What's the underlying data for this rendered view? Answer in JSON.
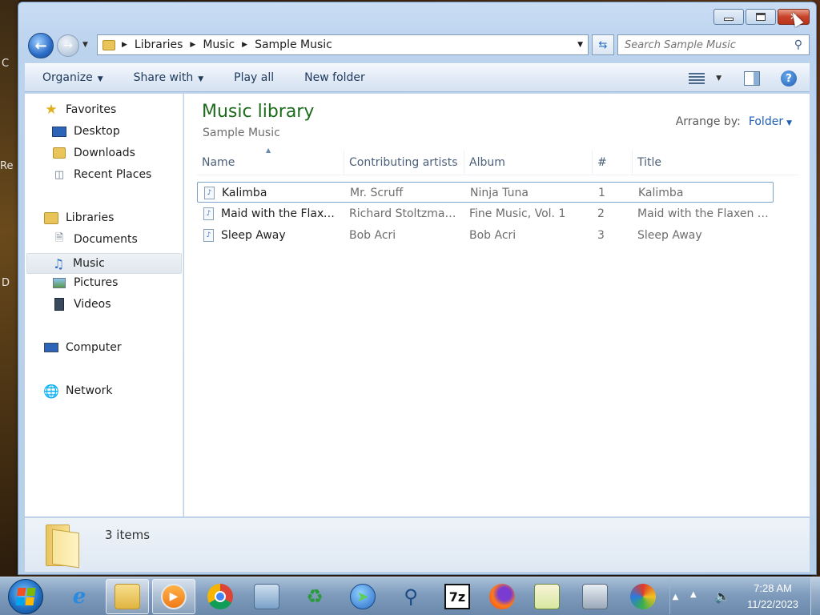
{
  "window": {
    "caption": {
      "minimize": "–",
      "maximize": "□",
      "close": "✕"
    }
  },
  "address_bar": {
    "breadcrumb": [
      "Libraries",
      "Music",
      "Sample Music"
    ]
  },
  "search": {
    "placeholder": "Search Sample Music"
  },
  "command_bar": {
    "organize": "Organize",
    "share_with": "Share with",
    "play_all": "Play all",
    "new_folder": "New folder"
  },
  "nav_pane": {
    "favorites": {
      "label": "Favorites",
      "items": [
        "Desktop",
        "Downloads",
        "Recent Places"
      ]
    },
    "libraries": {
      "label": "Libraries",
      "items": [
        "Documents",
        "Music",
        "Pictures",
        "Videos"
      ],
      "selected": "Music"
    },
    "computer": "Computer",
    "network": "Network"
  },
  "content": {
    "title": "Music library",
    "subtitle": "Sample Music",
    "arrange_by_label": "Arrange by:",
    "arrange_by_value": "Folder",
    "columns": [
      "Name",
      "Contributing artists",
      "Album",
      "#",
      "Title"
    ],
    "rows": [
      {
        "name": "Kalimba",
        "artists": "Mr. Scruff",
        "album": "Ninja Tuna",
        "num": "1",
        "title": "Kalimba",
        "selected": true
      },
      {
        "name": "Maid with the Flaxe...",
        "artists": "Richard Stoltzman;...",
        "album": "Fine Music, Vol. 1",
        "num": "2",
        "title": "Maid with the Flaxen H...",
        "selected": false
      },
      {
        "name": "Sleep Away",
        "artists": "Bob Acri",
        "album": "Bob Acri",
        "num": "3",
        "title": "Sleep Away",
        "selected": false
      }
    ]
  },
  "details_pane": {
    "item_count": "3 items"
  },
  "taskbar": {
    "clock_time": "7:28 AM",
    "clock_date": "11/22/2023",
    "icons": [
      "internet-explorer-icon",
      "file-explorer-icon",
      "media-player-icon",
      "chrome-icon",
      "server-manager-icon",
      "recycle-tools-icon",
      "network-globe-icon",
      "magnifier-icon",
      "7zip-icon",
      "firefox-icon",
      "notepad-icon",
      "fax-printer-icon",
      "paint-icon"
    ],
    "zip_label": "7z"
  },
  "desktop_edge_text": [
    "C",
    "Re",
    "D"
  ],
  "colors": {
    "library_title": "#1e6b1e",
    "link_blue": "#1f5fb4",
    "close_button": "#c8432a"
  }
}
